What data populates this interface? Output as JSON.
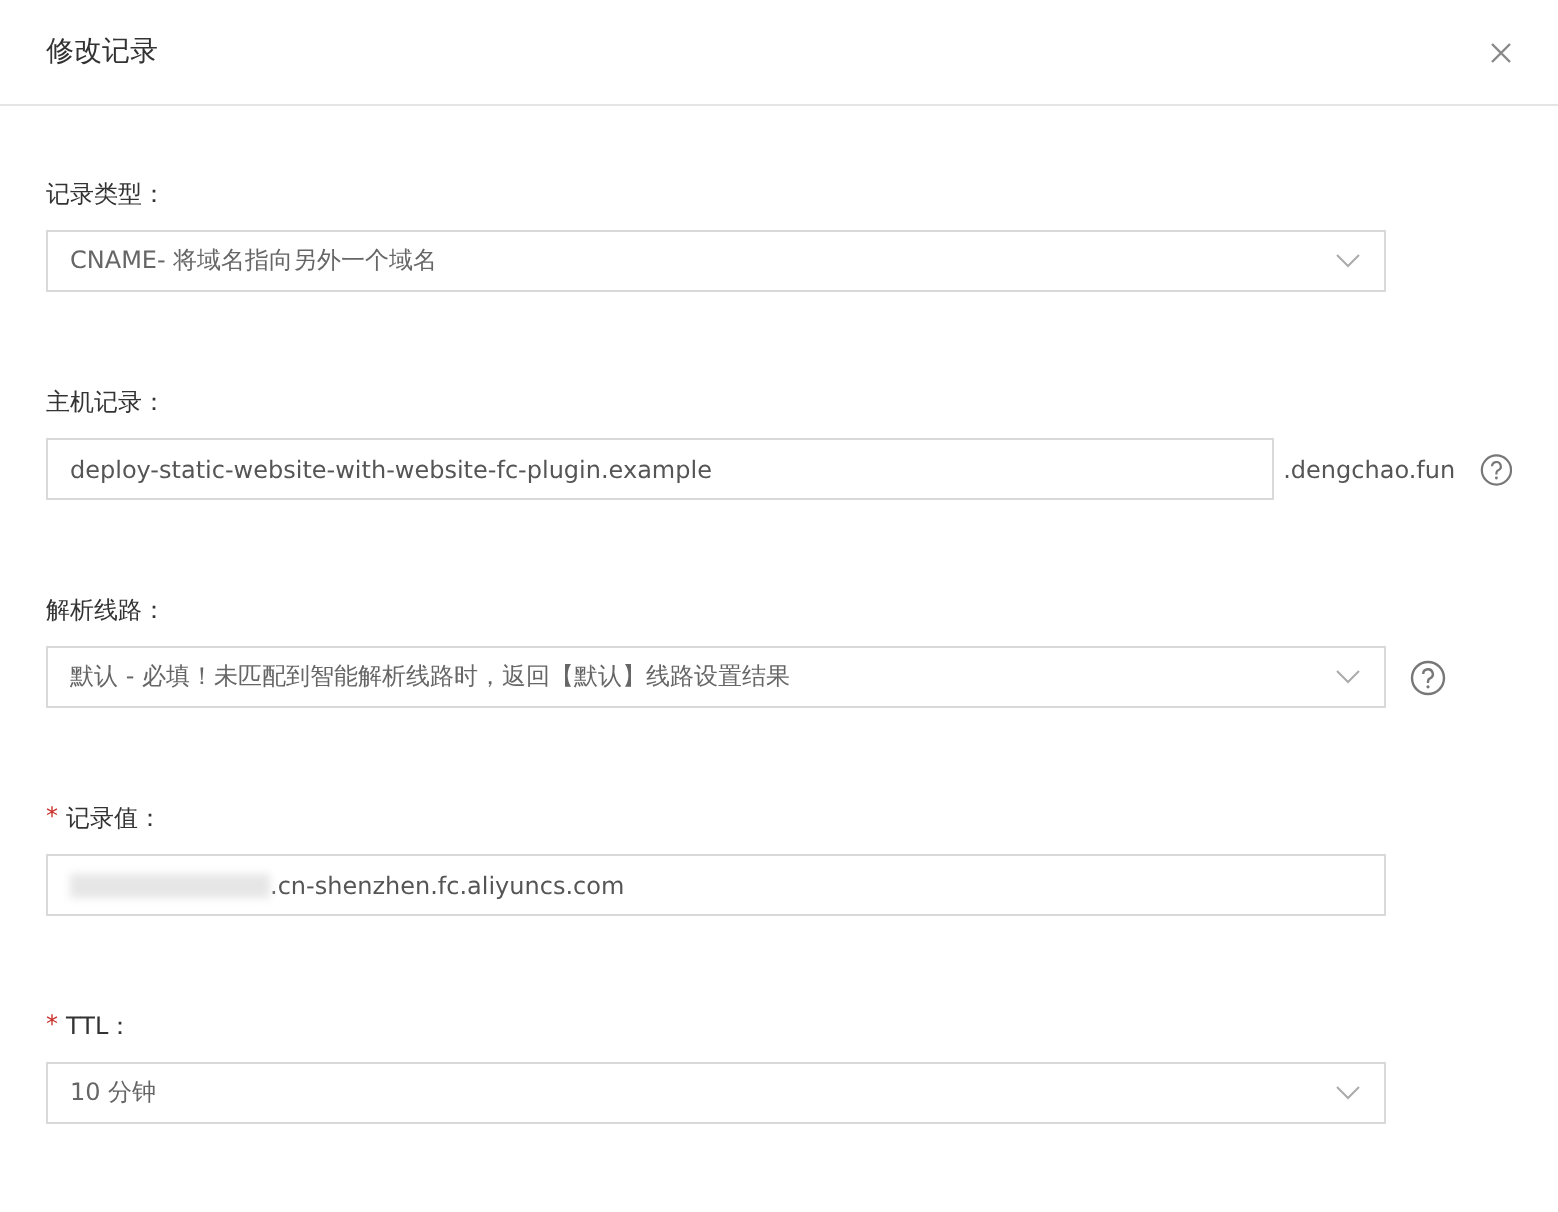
{
  "dialog": {
    "title": "修改记录"
  },
  "fields": [
    {
      "kind": "select",
      "label": "记录类型：",
      "value": "CNAME- 将域名指向另外一个域名",
      "help": false
    },
    {
      "kind": "input",
      "label": "主机记录：",
      "value": "deploy-static-website-with-website-fc-plugin.example",
      "suffix": ".dengchao.fun",
      "help": true
    },
    {
      "kind": "select",
      "label": "解析线路：",
      "value": "默认 - 必填！未匹配到智能解析线路时，返回【默认】线路设置结果",
      "help": true
    },
    {
      "kind": "input",
      "label": "记录值：",
      "required_mark": "*",
      "value": ".cn-shenzhen.fc.aliyuncs.com",
      "redacted": true,
      "help": false
    },
    {
      "kind": "select",
      "label": "TTL：",
      "required_mark": "*",
      "value": "10 分钟",
      "help": false
    }
  ]
}
